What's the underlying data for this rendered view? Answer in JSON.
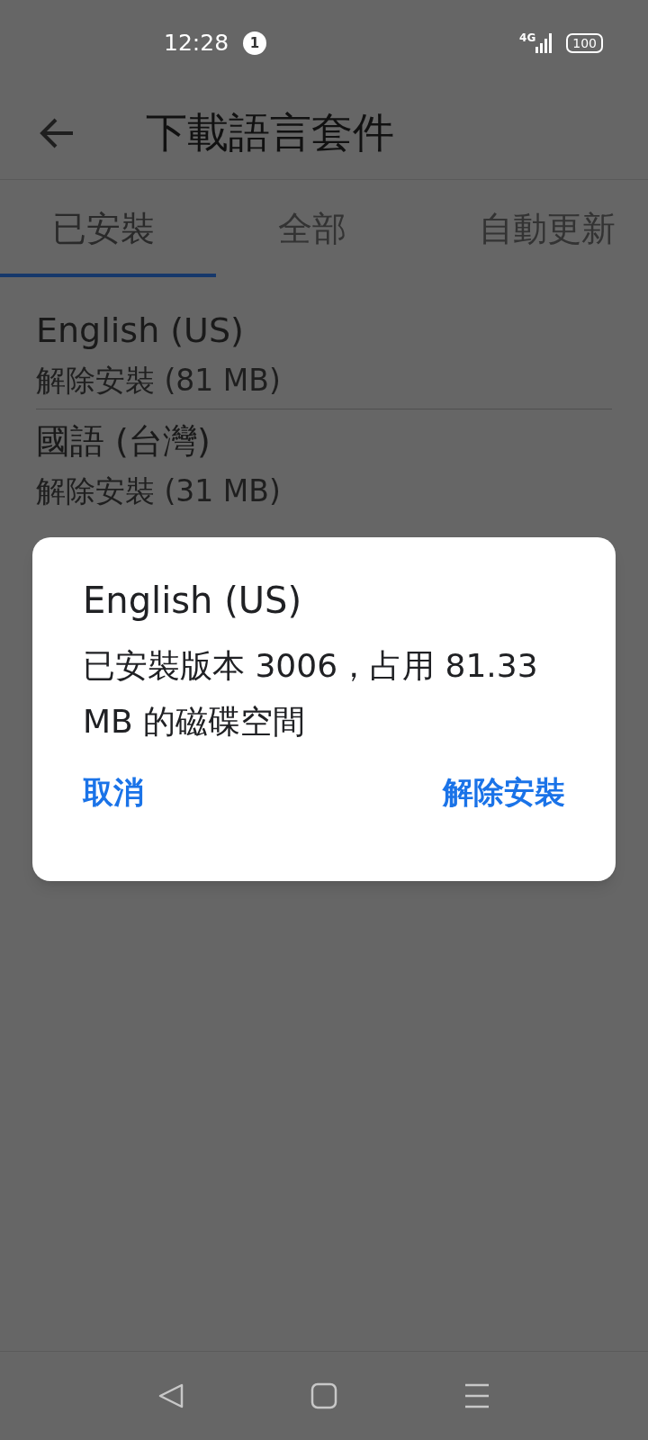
{
  "status_bar": {
    "time": "12:28",
    "notification_count": "1",
    "network": "4G",
    "battery": "100"
  },
  "app_bar": {
    "title": "下載語言套件"
  },
  "tabs": [
    {
      "label": "已安裝",
      "selected": true
    },
    {
      "label": "全部",
      "selected": false
    },
    {
      "label": "自動更新",
      "selected": false
    }
  ],
  "languages": [
    {
      "name": "English (US)",
      "action": "解除安裝 (81 MB)"
    },
    {
      "name": "國語 (台灣)",
      "action": "解除安裝 (31 MB)"
    }
  ],
  "dialog": {
    "title": "English (US)",
    "message": "已安裝版本 3006，占用 81.33 MB 的磁碟空間",
    "buttons": [
      "取消",
      "解除安裝"
    ]
  }
}
